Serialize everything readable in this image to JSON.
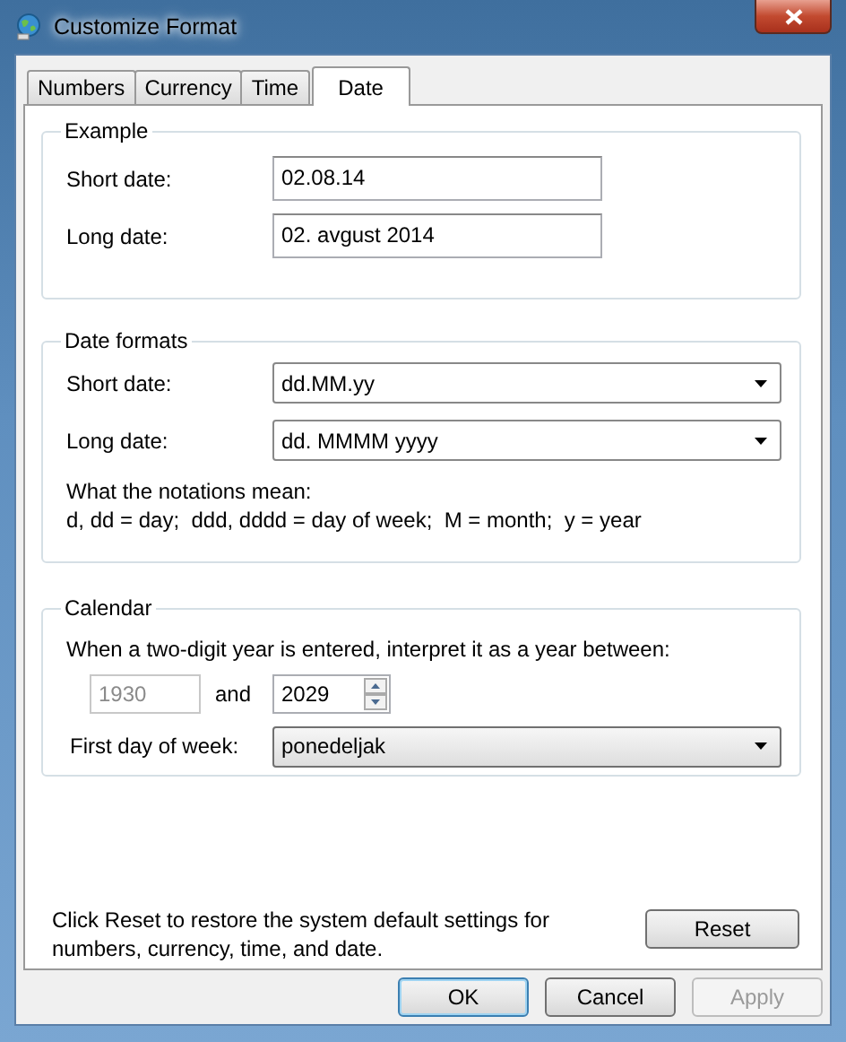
{
  "window": {
    "title": "Customize Format"
  },
  "tabs": [
    {
      "label": "Numbers",
      "selected": false
    },
    {
      "label": "Currency",
      "selected": false
    },
    {
      "label": "Time",
      "selected": false
    },
    {
      "label": "Date",
      "selected": true
    }
  ],
  "example": {
    "title": "Example",
    "fields": [
      {
        "label": "Short date:",
        "value": "02.08.14"
      },
      {
        "label": "Long date:",
        "value": "02. avgust 2014"
      }
    ]
  },
  "date_formats": {
    "title": "Date formats",
    "fields": [
      {
        "label": "Short date:",
        "value": "dd.MM.yy"
      },
      {
        "label": "Long date:",
        "value": "dd. MMMM yyyy"
      }
    ],
    "notation_heading": "What the notations mean:",
    "notation_text": "d, dd = day;  ddd, dddd = day of week;  M = month;  y = year"
  },
  "calendar": {
    "title": "Calendar",
    "range_label": "When a two-digit year is entered, interpret it as a year between:",
    "start_year": {
      "value": "1930",
      "disabled": true
    },
    "connector": "and",
    "end_year": {
      "value": "2029",
      "disabled": false
    },
    "first_day": {
      "label": "First day of week:",
      "value": "ponedeljak"
    }
  },
  "reset": {
    "text": "Click Reset to restore the system default settings for numbers, currency, time, and date.",
    "button": "Reset"
  },
  "buttons": [
    {
      "label": "OK",
      "default": true,
      "disabled": false
    },
    {
      "label": "Cancel",
      "default": false,
      "disabled": false
    },
    {
      "label": "Apply",
      "default": false,
      "disabled": true
    }
  ]
}
